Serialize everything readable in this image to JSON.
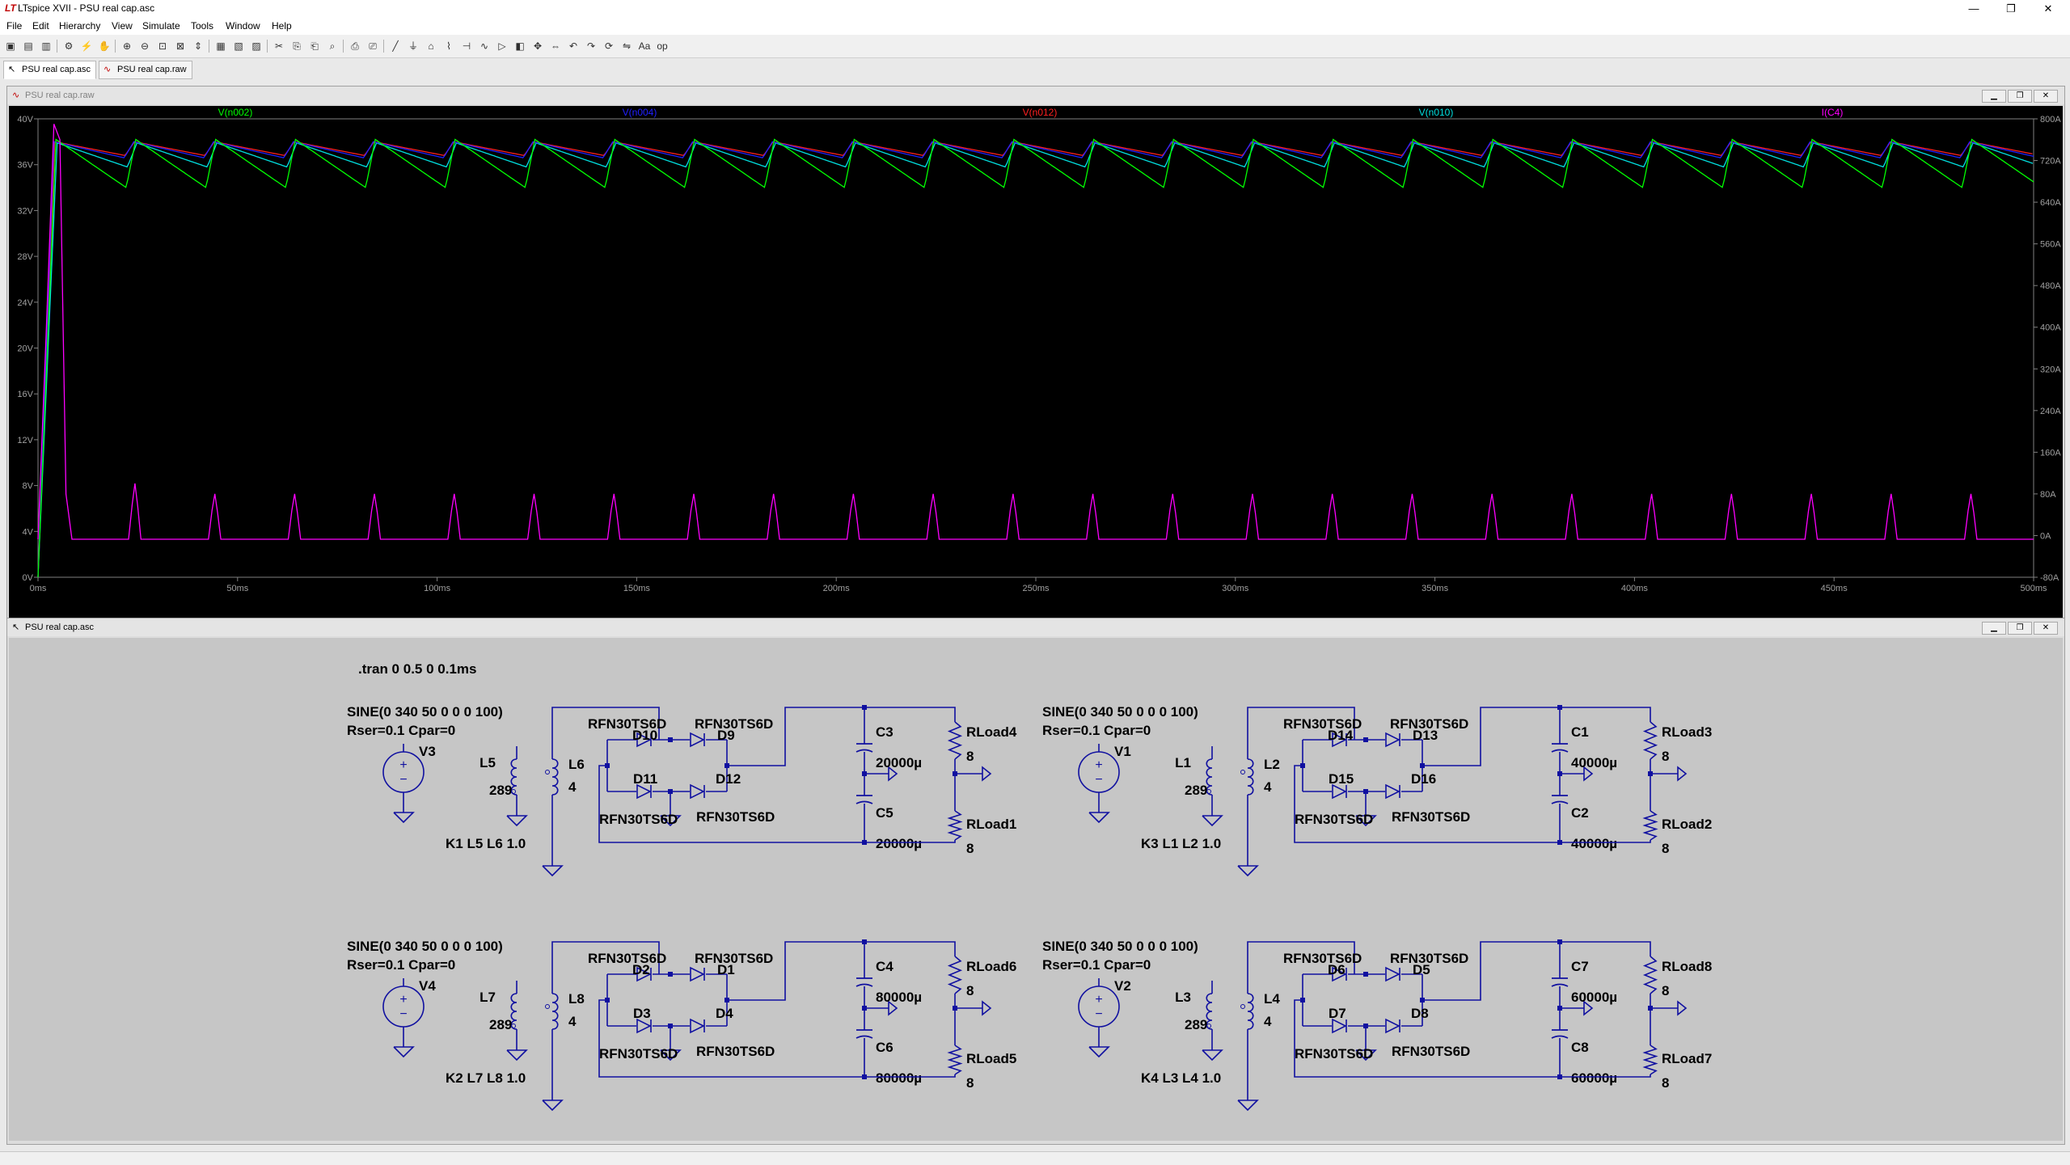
{
  "window": {
    "title": "LTspice XVII - PSU real cap.asc",
    "app_icon": "ltspice-logo-icon",
    "min": "—",
    "max": "❐",
    "close": "✕"
  },
  "menu": [
    "File",
    "Edit",
    "Hierarchy",
    "View",
    "Simulate",
    "Tools",
    "Window",
    "Help"
  ],
  "tabs": [
    {
      "label": "PSU real cap.asc",
      "icon": "schematic-icon"
    },
    {
      "label": "PSU real cap.raw",
      "icon": "waveform-icon"
    }
  ],
  "plot": {
    "title": "PSU real cap.raw",
    "traces": [
      {
        "name": "V(n002)",
        "color": "#00ff00"
      },
      {
        "name": "V(n004)",
        "color": "#2020ff"
      },
      {
        "name": "V(n012)",
        "color": "#ff2020"
      },
      {
        "name": "V(n010)",
        "color": "#00e0e0"
      },
      {
        "name": "I(C4)",
        "color": "#ff00ff"
      }
    ],
    "left_ticks": [
      "40V",
      "36V",
      "32V",
      "28V",
      "24V",
      "20V",
      "16V",
      "12V",
      "8V",
      "4V",
      "0V"
    ],
    "right_ticks": [
      "800A",
      "720A",
      "640A",
      "560A",
      "480A",
      "400A",
      "320A",
      "240A",
      "160A",
      "80A",
      "0A",
      "-80A"
    ],
    "x_ticks": [
      "0ms",
      "50ms",
      "100ms",
      "150ms",
      "200ms",
      "250ms",
      "300ms",
      "350ms",
      "400ms",
      "450ms",
      "500ms"
    ]
  },
  "chart_data": {
    "type": "line",
    "x_unit": "ms",
    "xlim": [
      0,
      500
    ],
    "left_axis": {
      "unit": "V",
      "ylim": [
        0,
        40
      ]
    },
    "right_axis": {
      "unit": "A",
      "ylim": [
        -80,
        800
      ]
    },
    "series": [
      {
        "name": "V(n002)",
        "axis": "left",
        "period_ms": 20,
        "peak": 38.2,
        "trough": 34.0
      },
      {
        "name": "V(n004)",
        "axis": "left",
        "period_ms": 20,
        "peak": 38.0,
        "trough": 36.6
      },
      {
        "name": "V(n012)",
        "axis": "left",
        "period_ms": 20,
        "peak": 38.0,
        "trough": 36.8
      },
      {
        "name": "V(n010)",
        "axis": "left",
        "period_ms": 20,
        "peak": 37.9,
        "trough": 35.8
      },
      {
        "name": "I(C4)",
        "axis": "right",
        "period_ms": 20,
        "peak": 80,
        "base": -7
      }
    ]
  },
  "schematic": {
    "title": "PSU real cap.asc",
    "directive": ".tran 0 0.5 0 0.1ms",
    "blocks": [
      {
        "sine": "SINE(0 340 50 0 0 0 100)",
        "rser": "Rser=0.1 Cpar=0",
        "src": "V3",
        "lp": "L5",
        "lp_val": "289",
        "ls": "L6",
        "ls_val": "4",
        "k": "K1 L5 L6 1.0",
        "d_tl": "D10",
        "d_tr": "D9",
        "d_bl": "D11",
        "d_br": "D12",
        "dmodel": "RFN30TS6D",
        "c_top": "C3",
        "c_top_val": "20000µ",
        "c_bot": "C5",
        "c_bot_val": "20000µ",
        "r_top": "RLoad4",
        "r_top_val": "8",
        "r_bot": "RLoad1",
        "r_bot_val": "8"
      },
      {
        "sine": "SINE(0 340 50 0 0 0 100)",
        "rser": "Rser=0.1 Cpar=0",
        "src": "V1",
        "lp": "L1",
        "lp_val": "289",
        "ls": "L2",
        "ls_val": "4",
        "k": "K3 L1 L2 1.0",
        "d_tl": "D14",
        "d_tr": "D13",
        "d_bl": "D15",
        "d_br": "D16",
        "dmodel": "RFN30TS6D",
        "c_top": "C1",
        "c_top_val": "40000µ",
        "c_bot": "C2",
        "c_bot_val": "40000µ",
        "r_top": "RLoad3",
        "r_top_val": "8",
        "r_bot": "RLoad2",
        "r_bot_val": "8"
      },
      {
        "sine": "SINE(0 340 50 0 0 0 100)",
        "rser": "Rser=0.1 Cpar=0",
        "src": "V4",
        "lp": "L7",
        "lp_val": "289",
        "ls": "L8",
        "ls_val": "4",
        "k": "K2 L7 L8 1.0",
        "d_tl": "D2",
        "d_tr": "D1",
        "d_bl": "D3",
        "d_br": "D4",
        "dmodel": "RFN30TS6D",
        "c_top": "C4",
        "c_top_val": "80000µ",
        "c_bot": "C6",
        "c_bot_val": "80000µ",
        "r_top": "RLoad6",
        "r_top_val": "8",
        "r_bot": "RLoad5",
        "r_bot_val": "8"
      },
      {
        "sine": "SINE(0 340 50 0 0 0 100)",
        "rser": "Rser=0.1 Cpar=0",
        "src": "V2",
        "lp": "L3",
        "lp_val": "289",
        "ls": "L4",
        "ls_val": "4",
        "k": "K4 L3 L4 1.0",
        "d_tl": "D6",
        "d_tr": "D5",
        "d_bl": "D7",
        "d_br": "D8",
        "dmodel": "RFN30TS6D",
        "c_top": "C7",
        "c_top_val": "60000µ",
        "c_bot": "C8",
        "c_bot_val": "60000µ",
        "r_top": "RLoad8",
        "r_top_val": "8",
        "r_bot": "RLoad7",
        "r_bot_val": "8"
      }
    ]
  },
  "toolbar_icons": [
    "new-schematic-icon",
    "open-icon",
    "save-icon",
    "control-panel-icon",
    "run-icon",
    "halt-icon",
    "zoom-in-icon",
    "zoom-out-icon",
    "zoom-fit-icon",
    "zoom-cancel-icon",
    "autorange-icon",
    "tile-icon",
    "cascade-icon",
    "close-all-icon",
    "cut-icon",
    "copy-icon",
    "paste-icon",
    "find-icon",
    "print-icon",
    "print-preview-icon",
    "wire-icon",
    "ground-icon",
    "label-icon",
    "resistor-icon",
    "capacitor-icon",
    "inductor-icon",
    "diode-icon",
    "component-icon",
    "move-icon",
    "drag-icon",
    "undo-icon",
    "redo-icon",
    "rotate-icon",
    "mirror-icon",
    "text-icon",
    "spice-directive-icon"
  ]
}
